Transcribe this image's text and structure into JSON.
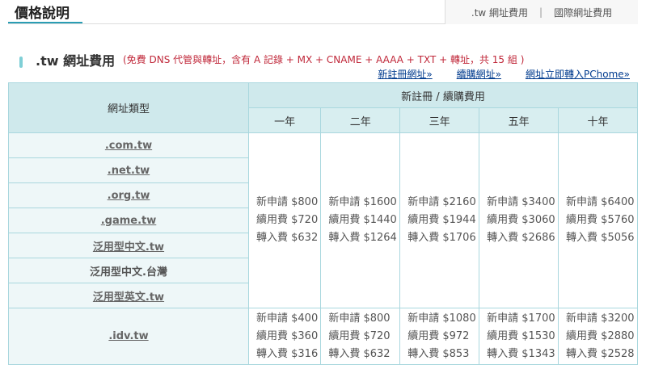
{
  "header": {
    "title": "價格說明",
    "tabs": [
      ".tw 網址費用",
      "國際網址費用"
    ],
    "separator": "|"
  },
  "section": {
    "title": ".tw 網址費用",
    "note": "(免費 DNS 代管與轉址，含有 A 記錄 + MX + CNAME + AAAA + TXT + 轉址，共 15 組 )"
  },
  "links": [
    "新註冊網址»",
    "續購網址»",
    "網址立即轉入PChome»"
  ],
  "table": {
    "type_header": "網址類型",
    "group_header": "新註冊 / 續購費用",
    "years": [
      "一年",
      "二年",
      "三年",
      "五年",
      "十年"
    ],
    "groups": [
      {
        "types": [
          {
            "label": ".com.tw",
            "link": true
          },
          {
            "label": ".net.tw",
            "link": true
          },
          {
            "label": ".org.tw",
            "link": true
          },
          {
            "label": ".game.tw",
            "link": true
          },
          {
            "label": "泛用型中文.tw",
            "link": true
          },
          {
            "label": "泛用型中文.台灣",
            "link": false
          },
          {
            "label": "泛用型英文.tw",
            "link": true
          }
        ],
        "prices": [
          [
            "新申請 $800",
            "續用費 $720",
            "轉入費 $632"
          ],
          [
            "新申請 $1600",
            "續用費 $1440",
            "轉入費 $1264"
          ],
          [
            "新申請 $2160",
            "續用費 $1944",
            "轉入費 $1706"
          ],
          [
            "新申請 $3400",
            "續用費 $3060",
            "轉入費 $2686"
          ],
          [
            "新申請 $6400",
            "續用費 $5760",
            "轉入費 $5056"
          ]
        ]
      },
      {
        "types": [
          {
            "label": ".idv.tw",
            "link": true
          }
        ],
        "prices": [
          [
            "新申請 $400",
            "續用費 $360",
            "轉入費 $316"
          ],
          [
            "新申請 $800",
            "續用費 $720",
            "轉入費 $632"
          ],
          [
            "新申請 $1080",
            "續用費 $972",
            "轉入費 $853"
          ],
          [
            "新申請 $1700",
            "續用費 $1530",
            "轉入費 $1343"
          ],
          [
            "新申請 $3200",
            "續用費 $2880",
            "轉入費 $2528"
          ]
        ]
      }
    ]
  }
}
